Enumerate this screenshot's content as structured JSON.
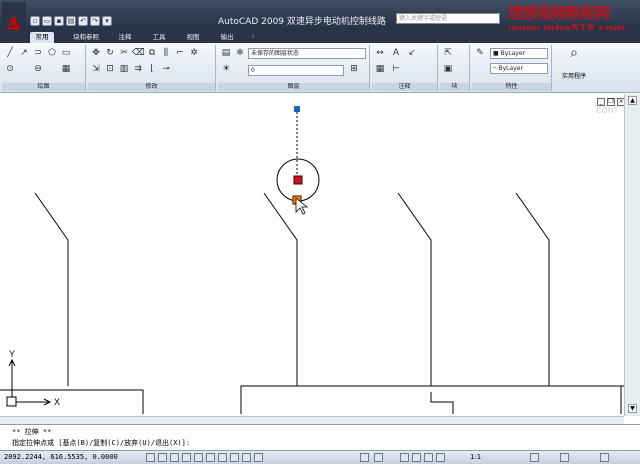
{
  "app": {
    "title": "AutoCAD 2009  双速异步电动机控制线路",
    "search_placeholder": "键入关键字或短语",
    "logo_letter": "A"
  },
  "watermark": {
    "line1": "理想视频教程网",
    "line2": "www.mba518.com"
  },
  "tabs": [
    "常用",
    "块和参照",
    "注释",
    "工具",
    "视图",
    "输出"
  ],
  "panels": {
    "draw": "绘图",
    "modify": "修改",
    "layers": "图层",
    "annotation": "注释",
    "block": "块",
    "properties": "特性"
  },
  "ribbon": {
    "layer_value": "未保存的图层状态",
    "utilities_label": "实用程序",
    "layer_name": "0"
  },
  "canvas": {
    "axis_y": "Y",
    "axis_x": "X",
    "corner_text": "com"
  },
  "command": {
    "line1": "** 拉伸 **",
    "line2": "指定拉伸点或 [基点(B)/复制(C)/放弃(U)/退出(X)]:"
  },
  "status": {
    "coordinates": "2092.2244, 616.5535, 0.0000",
    "scale": "1:1"
  },
  "colors": {
    "titlebar": "#2b3447",
    "accent_red": "#b8141c",
    "grip_blue": "#1f5fbf",
    "grip_red": "#d01020"
  }
}
